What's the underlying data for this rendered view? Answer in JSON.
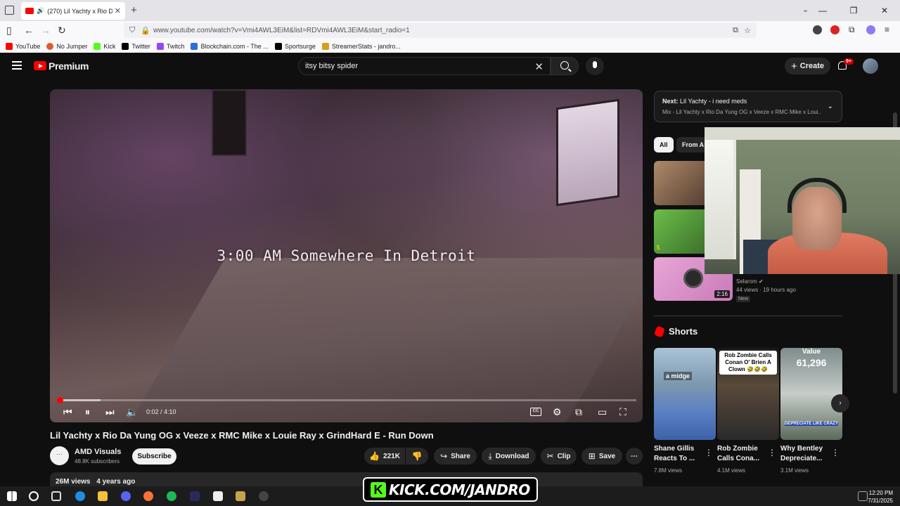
{
  "browser": {
    "tab_title": "(270) Lil Yachty x Rio Da Yu",
    "url": "www.youtube.com/watch?v=Vmi4AWL3EiM&list=RDVmi4AWL3EiM&start_radio=1",
    "bookmarks": [
      "YouTube",
      "No Jumper",
      "Kick",
      "Twitter",
      "Twitch",
      "Blockchain.com - The ...",
      "Sportsurge",
      "StreamerStats - jandro..."
    ],
    "bookmark_colors": [
      "#ff0000",
      "#e05a2b",
      "#53fc18",
      "#000000",
      "#9146ff",
      "#2d6cdf",
      "#000000",
      "#d4a017"
    ]
  },
  "header": {
    "logo_label": "Premium",
    "search_value": "itsy bitsy spider",
    "create_label": "Create",
    "notif_count": "9+"
  },
  "video": {
    "overlay_text": "3:00 AM Somewhere In Detroit",
    "time": "0:02 / 4:10",
    "progress": 0.008,
    "title": "Lil Yachty x Rio Da Yung OG x Veeze x RMC Mike x Louie Ray x GrindHard E - Run Down",
    "cc_label": "CC"
  },
  "channel": {
    "avatar_text": "···",
    "name": "AMD Visuals",
    "subs": "48.8K subscribers",
    "subscribe_label": "Subscribe"
  },
  "actions": {
    "likes": "221K",
    "share": "Share",
    "download": "Download",
    "clip": "Clip",
    "save": "Save"
  },
  "description": {
    "views": "26M views",
    "age": "4 years ago"
  },
  "upnext": {
    "prefix": "Next:",
    "title": "Lil Yachty - i need meds",
    "subtitle": "Mix - Lil Yachty x Rio Da Yung OG x Veeze x RMC Mike x Loui..."
  },
  "chips": [
    "All",
    "From A"
  ],
  "related": {
    "duration": "2:16",
    "channel": "Selarom",
    "meta": "44 views · 19 hours ago",
    "badge": "New",
    "small_label": "5"
  },
  "shorts": {
    "heading": "Shorts",
    "items": [
      {
        "title": "Shane Gillis Reacts To ...",
        "views": "7.8M views",
        "overlay": "a midge"
      },
      {
        "title": "Rob Zombie Calls Cona...",
        "views": "4.1M views",
        "overlay": "Rob Zombie Calls Conan O' Brien A Clown 🤣🤣🤣"
      },
      {
        "title": "Why Bentley Depreciate...",
        "views": "3.1M views",
        "overlay": "Value",
        "overlay2": "61,296",
        "overlay3": "DEPRECIATE LIKE CRAZY"
      }
    ]
  },
  "stream": {
    "kick_text": "KICK.COM/JANDRO"
  },
  "taskbar": {
    "time": "12:20 PM",
    "date": "7/31/2025"
  }
}
